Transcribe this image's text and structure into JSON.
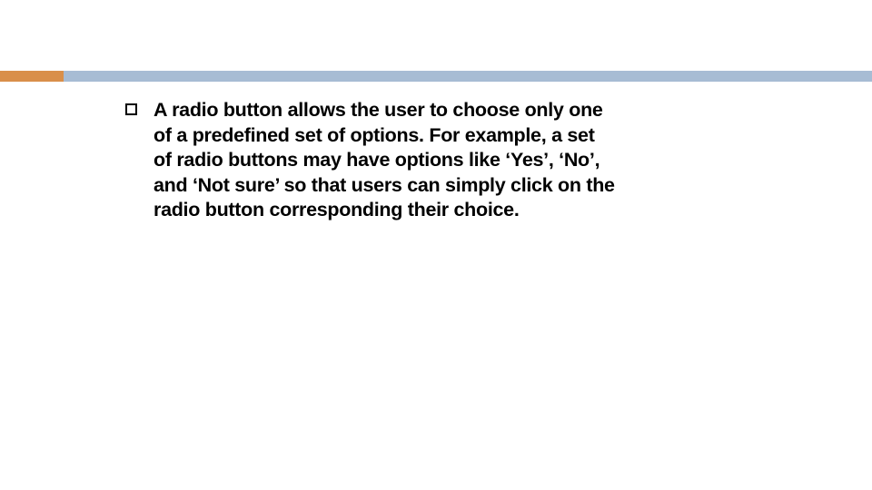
{
  "colors": {
    "accent": "#d98f4a",
    "bar": "#a7bcd4"
  },
  "content": {
    "bullet_text": "A radio button allows the user to choose only one of a predefined set of options. For example, a set of radio buttons may have options like ‘Yes’, ‘No’, and ‘Not sure’ so that users can simply click on the radio button corresponding their choice."
  }
}
